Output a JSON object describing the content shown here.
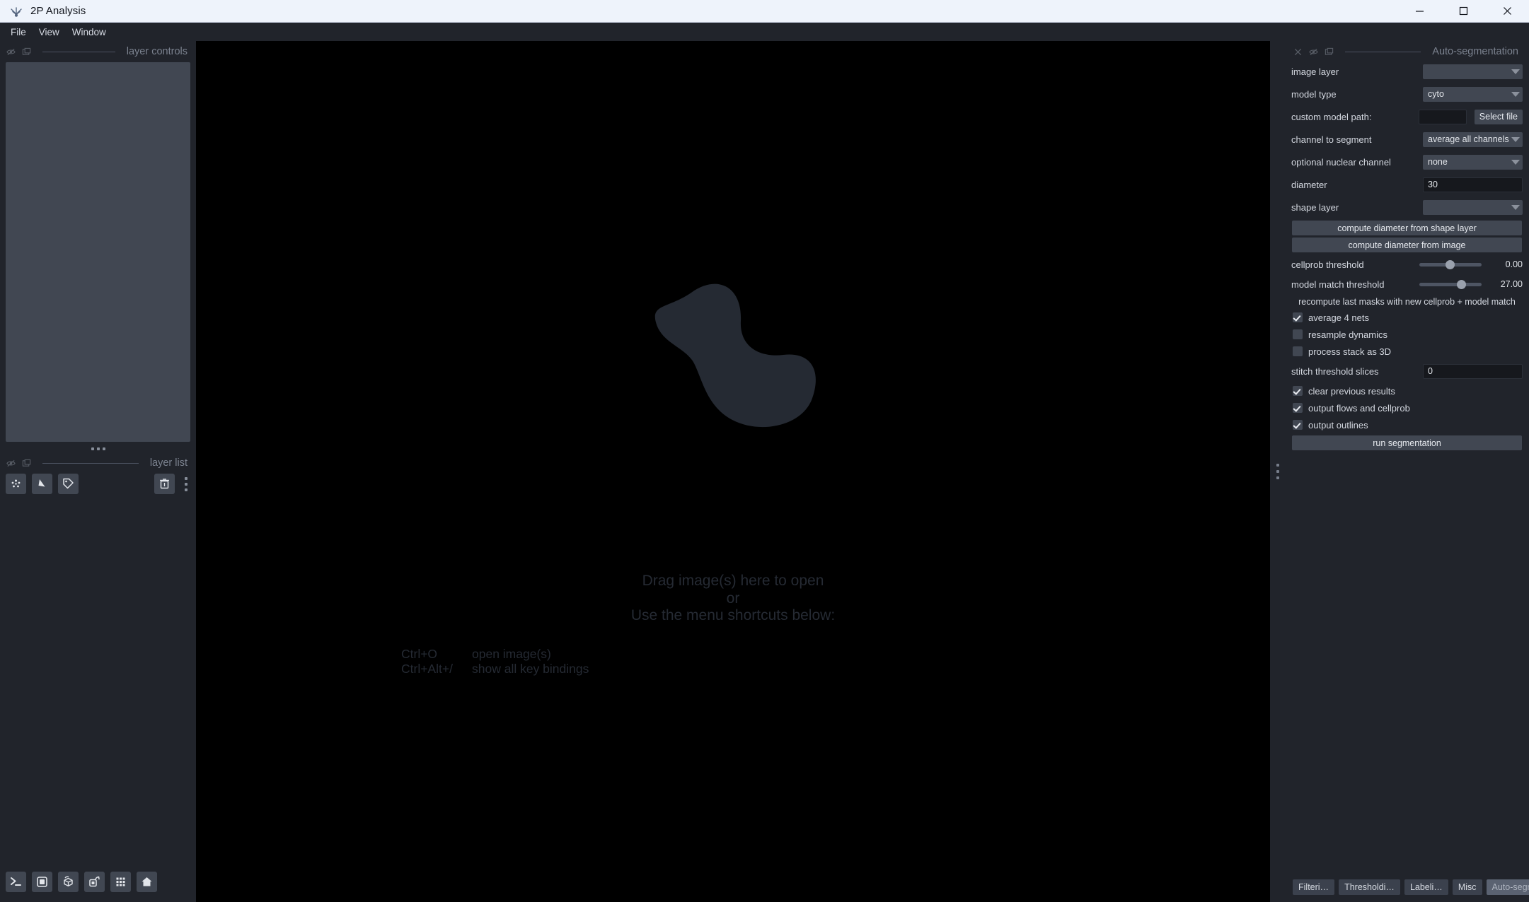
{
  "window": {
    "title": "2P Analysis",
    "app_icon": "napari-logo-icon",
    "minimize_label": "─",
    "maximize_label": "□",
    "close_label": "✕"
  },
  "menubar": {
    "items": [
      {
        "label": "File"
      },
      {
        "label": "View"
      },
      {
        "label": "Window"
      }
    ]
  },
  "left_dock": {
    "layer_controls": {
      "title": "layer controls",
      "icons": [
        "float-dock-icon",
        "dock-window-icon"
      ]
    },
    "layer_list": {
      "title": "layer list",
      "icons": [
        "float-dock-icon",
        "dock-window-icon"
      ],
      "new_points_label": "new-points-icon",
      "new_shapes_label": "new-shapes-icon",
      "new_labels_label": "new-labels-icon",
      "delete_label": "trash-icon"
    },
    "viewer_buttons": [
      {
        "name": "console-button",
        "icon": "console-icon"
      },
      {
        "name": "ndisplay-2d-button",
        "icon": "square-2d-icon"
      },
      {
        "name": "ndisplay-3d-button",
        "icon": "cube-3d-icon"
      },
      {
        "name": "roll-dims-button",
        "icon": "roll-dims-icon"
      },
      {
        "name": "transpose-dims-button",
        "icon": "grid-icon"
      },
      {
        "name": "reset-view-button",
        "icon": "home-icon"
      }
    ]
  },
  "canvas": {
    "logo": "napari-blob-logo",
    "welcome_line_1": "Drag image(s) here to open",
    "welcome_line_2": "or",
    "welcome_line_3": "Use the menu shortcuts below:",
    "shortcuts": [
      {
        "keys": "Ctrl+O",
        "action": "open image(s)"
      },
      {
        "keys": "Ctrl+Alt+/",
        "action": "show all key bindings"
      }
    ]
  },
  "right_dock": {
    "title": "Auto-segmentation",
    "header_icons": [
      "close-icon",
      "float-dock-icon",
      "dock-window-icon"
    ],
    "fields": {
      "image_layer": {
        "label": "image layer",
        "value": ""
      },
      "model_type": {
        "label": "model type",
        "value": "cyto"
      },
      "custom_model_path": {
        "label": "custom model path:",
        "value": "",
        "button": "Select file"
      },
      "channel_to_segment": {
        "label": "channel to segment",
        "value": "average all channels"
      },
      "optional_nuclear_channel": {
        "label": "optional nuclear channel",
        "value": "none"
      },
      "diameter": {
        "label": "diameter",
        "value": "30"
      },
      "shape_layer": {
        "label": "shape layer",
        "value": ""
      },
      "stitch_threshold_slices": {
        "label": "stitch threshold slices",
        "value": "0"
      }
    },
    "buttons": {
      "compute_diameter_shape": "compute diameter from shape layer",
      "compute_diameter_image": "compute diameter from image",
      "recompute_note": "recompute last masks with new cellprob + model match",
      "run_segmentation": "run segmentation"
    },
    "sliders": [
      {
        "label": "cellprob threshold",
        "value": "0.00",
        "percent": 50
      },
      {
        "label": "model match threshold",
        "value": "27.00",
        "percent": 70
      }
    ],
    "checkboxes": [
      {
        "label": "average 4 nets",
        "checked": true
      },
      {
        "label": "resample dynamics",
        "checked": false
      },
      {
        "label": "process stack as 3D",
        "checked": false
      }
    ],
    "checkboxes_lower": [
      {
        "label": "clear previous results",
        "checked": true
      },
      {
        "label": "output flows and cellprob",
        "checked": true
      },
      {
        "label": "output outlines",
        "checked": true
      }
    ],
    "tabs": [
      {
        "label": "Filteri…",
        "active": false
      },
      {
        "label": "Thresholdi…",
        "active": false
      },
      {
        "label": "Labeli…",
        "active": false
      },
      {
        "label": "Misc",
        "active": false
      },
      {
        "label": "Auto-segmentati…",
        "active": true
      }
    ]
  },
  "colors": {
    "window_chrome": "#eef3fb",
    "panel_bg": "#21242b",
    "widget_bg": "#414752",
    "canvas_bg": "#000000",
    "logo_fill": "#252a33",
    "text_primary": "#d4d8e0",
    "text_muted": "#7b828f",
    "accent_active_tab": "#5a6271"
  }
}
